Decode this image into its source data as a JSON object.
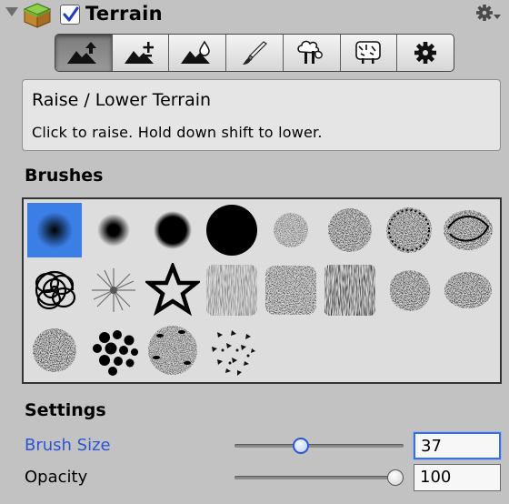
{
  "header": {
    "title": "Terrain",
    "enabled": true,
    "icons": [
      "foldout-arrow-icon",
      "terrain-cube-icon",
      "gear-icon"
    ]
  },
  "toolbar": {
    "tools": [
      {
        "name": "raise-lower-terrain",
        "icon": "mountain-up-arrow-icon"
      },
      {
        "name": "paint-height",
        "icon": "mountain-plus-icon"
      },
      {
        "name": "smooth-height",
        "icon": "mountain-drop-icon"
      },
      {
        "name": "paint-texture",
        "icon": "paintbrush-icon"
      },
      {
        "name": "place-trees",
        "icon": "trees-icon"
      },
      {
        "name": "paint-details",
        "icon": "details-icon"
      },
      {
        "name": "terrain-settings",
        "icon": "gear-icon"
      }
    ],
    "active_index": 0
  },
  "info": {
    "title": "Raise / Lower Terrain",
    "description": "Click to raise. Hold down shift to lower."
  },
  "brushes": {
    "heading": "Brushes",
    "selected_index": 0,
    "count": 20
  },
  "settings": {
    "heading": "Settings",
    "brush_size": {
      "label": "Brush Size",
      "value": "37",
      "slider_fraction": 0.38
    },
    "opacity": {
      "label": "Opacity",
      "value": "100",
      "slider_fraction": 1.0
    }
  },
  "colors": {
    "panel": "#c2c2c2",
    "selection": "#3a7ee6",
    "focus": "#2c55d6"
  }
}
